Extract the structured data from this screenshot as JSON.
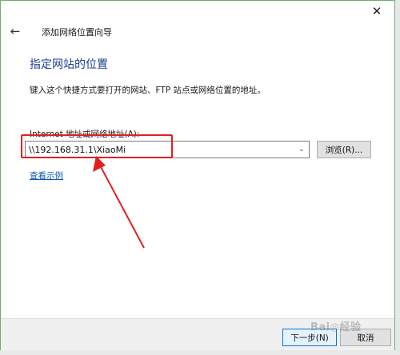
{
  "window": {
    "close_glyph": "✕",
    "back_glyph": "←",
    "wizard_title": "添加网络位置向导"
  },
  "page": {
    "heading": "指定网站的位置",
    "instruction": "键入这个快捷方式要打开的网站、FTP 站点或网络位置的地址。",
    "field_label": "Internet 地址或网络地址(A):",
    "address_value": "\\\\192.168.31.1\\XiaoMi",
    "browse_label": "浏览(R)...",
    "example_link": "查看示例"
  },
  "footer": {
    "next_label": "下一步(N)",
    "cancel_label": "取消"
  },
  "watermark": {
    "text": "Bai◎经验"
  },
  "colors": {
    "heading_blue": "#1b3d8f",
    "annotation_red": "#e02020",
    "link_blue": "#0b57b4",
    "focus_blue": "#0078d7"
  }
}
